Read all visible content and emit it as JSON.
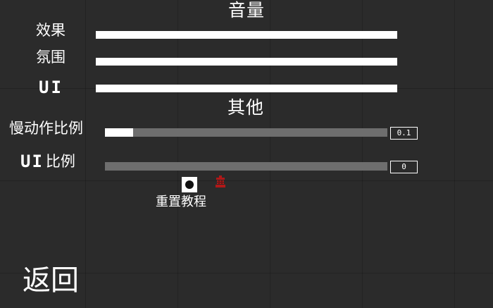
{
  "volume": {
    "title": "音量",
    "effects_label": "效果",
    "ambience_label": "氛围",
    "ui_label": "UI"
  },
  "other": {
    "title": "其他",
    "slowmo_label": "慢动作比例",
    "slowmo_value": "0.1",
    "slowmo_level": 0.1,
    "ui_scale_label_prefix": "UI",
    "ui_scale_label_suffix": "比例",
    "ui_scale_value": "0",
    "ui_scale_level": 0
  },
  "reset_tutorial": {
    "label": "重置教程"
  },
  "back_label": "返回",
  "colors": {
    "background": "#2b2b2b",
    "track": "#6e6e6e",
    "fill": "#ffffff",
    "warning_icon": "#b01818"
  },
  "icons": {
    "reset_indicator": "warning-glyph-icon"
  }
}
